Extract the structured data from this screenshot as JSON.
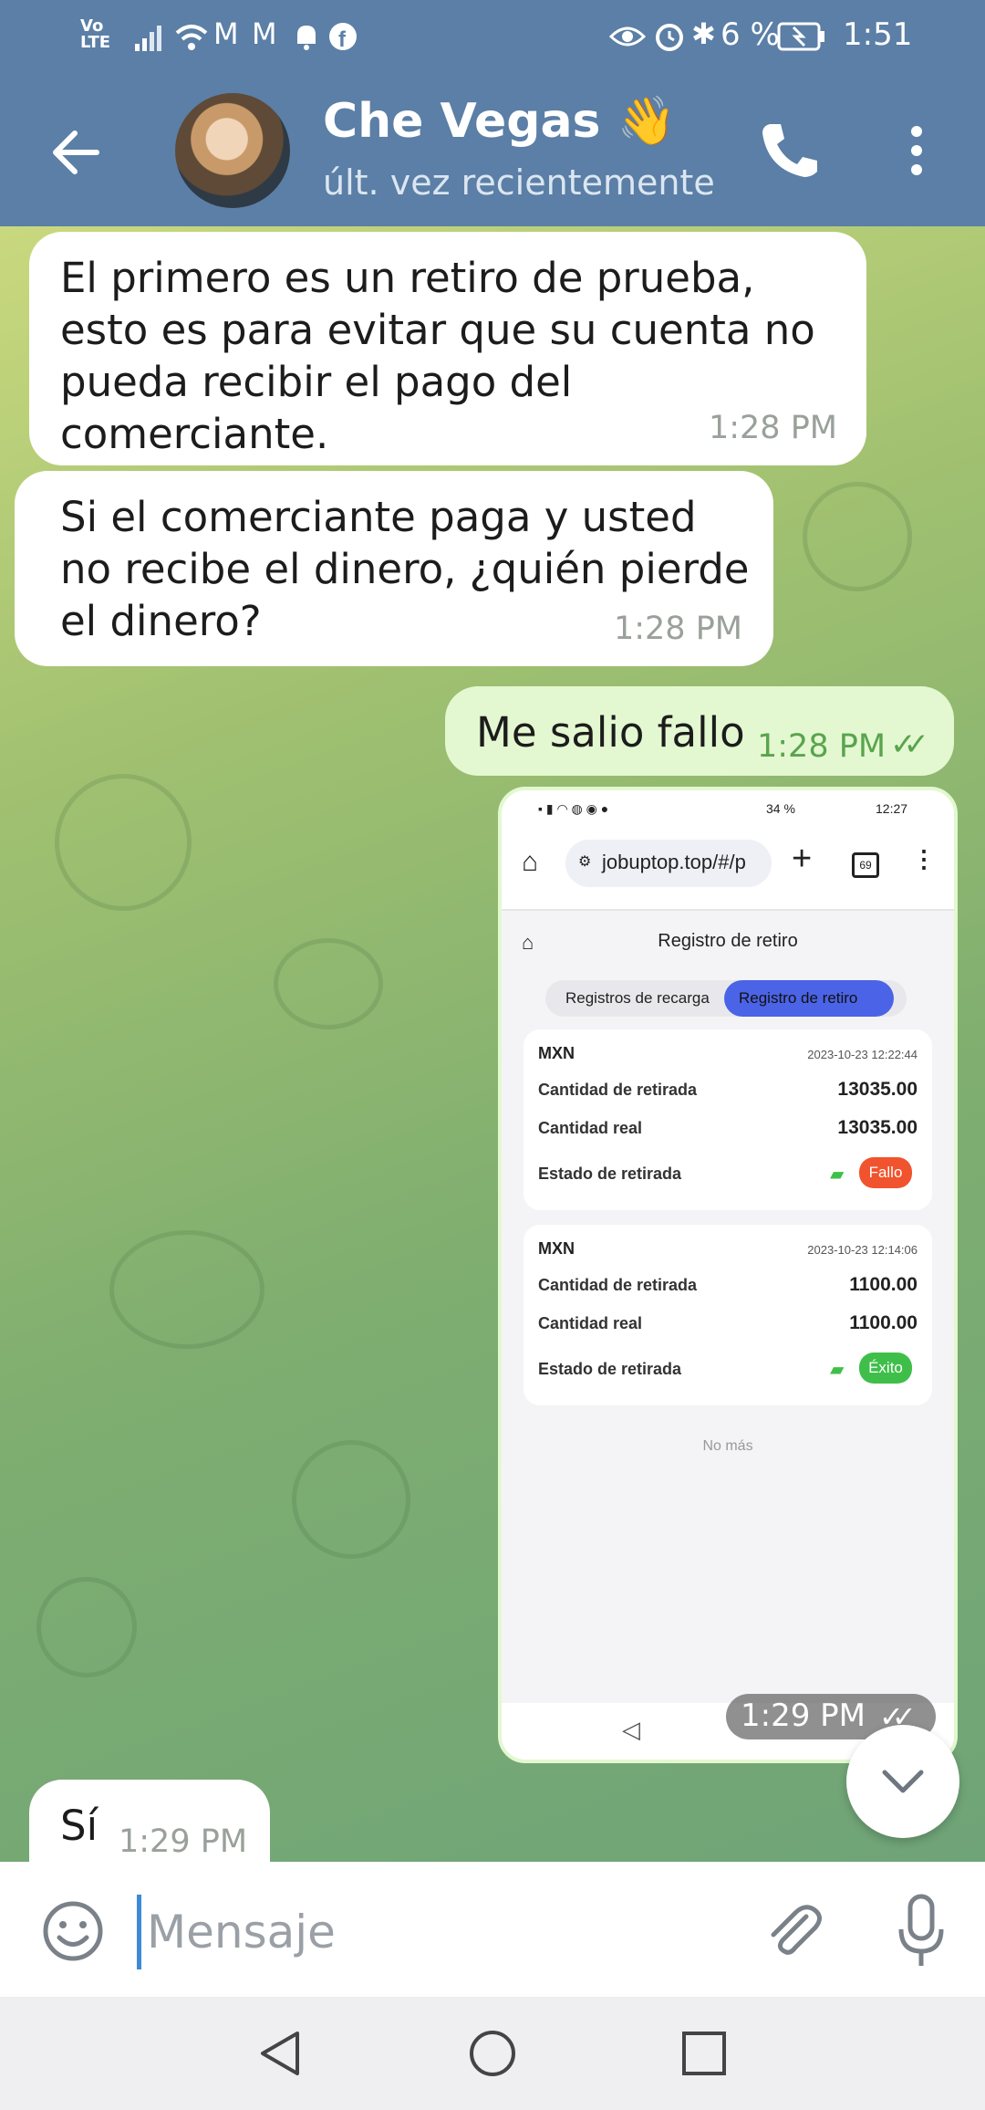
{
  "status_bar": {
    "network": "Vo LTE",
    "battery": "6 %",
    "time": "1:51"
  },
  "header": {
    "name": "Che Vegas",
    "emoji": "👋",
    "status": "últ. vez recientemente"
  },
  "messages": [
    {
      "dir": "in",
      "text": "El primero es un retiro de prueba, esto es para evitar que su cuenta no pueda recibir el pago del comerciante.",
      "time": "1:28 PM"
    },
    {
      "dir": "in",
      "text": "Si el comerciante paga y usted no recibe el dinero, ¿quién pierde el dinero?",
      "time": "1:28 PM"
    },
    {
      "dir": "out",
      "text": "Me salio fallo",
      "time": "1:28 PM",
      "read": true
    },
    {
      "dir": "out",
      "type": "photo",
      "time": "1:29 PM",
      "read": true
    },
    {
      "dir": "in",
      "text": "Sí",
      "time": "1:29 PM"
    }
  ],
  "photo": {
    "status_time": "12:27",
    "status_battery": "34 %",
    "url": "jobuptop.top/#/p",
    "tabs_count": "69",
    "page_title": "Registro de retiro",
    "tab_recharge": "Registros de recarga",
    "tab_withdraw": "Registro de retiro",
    "records": [
      {
        "currency": "MXN",
        "datetime": "2023-10-23 12:22:44",
        "amount_label": "Cantidad de retirada",
        "amount": "13035.00",
        "real_label": "Cantidad real",
        "real": "13035.00",
        "state_label": "Estado de retirada",
        "state": "Fallo",
        "state_color": "#f0532d"
      },
      {
        "currency": "MXN",
        "datetime": "2023-10-23 12:14:06",
        "amount_label": "Cantidad de retirada",
        "amount": "1100.00",
        "real_label": "Cantidad real",
        "real": "1100.00",
        "state_label": "Estado de retirada",
        "state": "Éxito",
        "state_color": "#3fbf4a"
      }
    ],
    "footer": "No más"
  },
  "input": {
    "placeholder": "Mensaje"
  },
  "colors": {
    "header": "#5b7fa6",
    "incoming": "#ffffff",
    "outgoing": "#e3f8d0",
    "accent_green": "#5aa44e"
  }
}
